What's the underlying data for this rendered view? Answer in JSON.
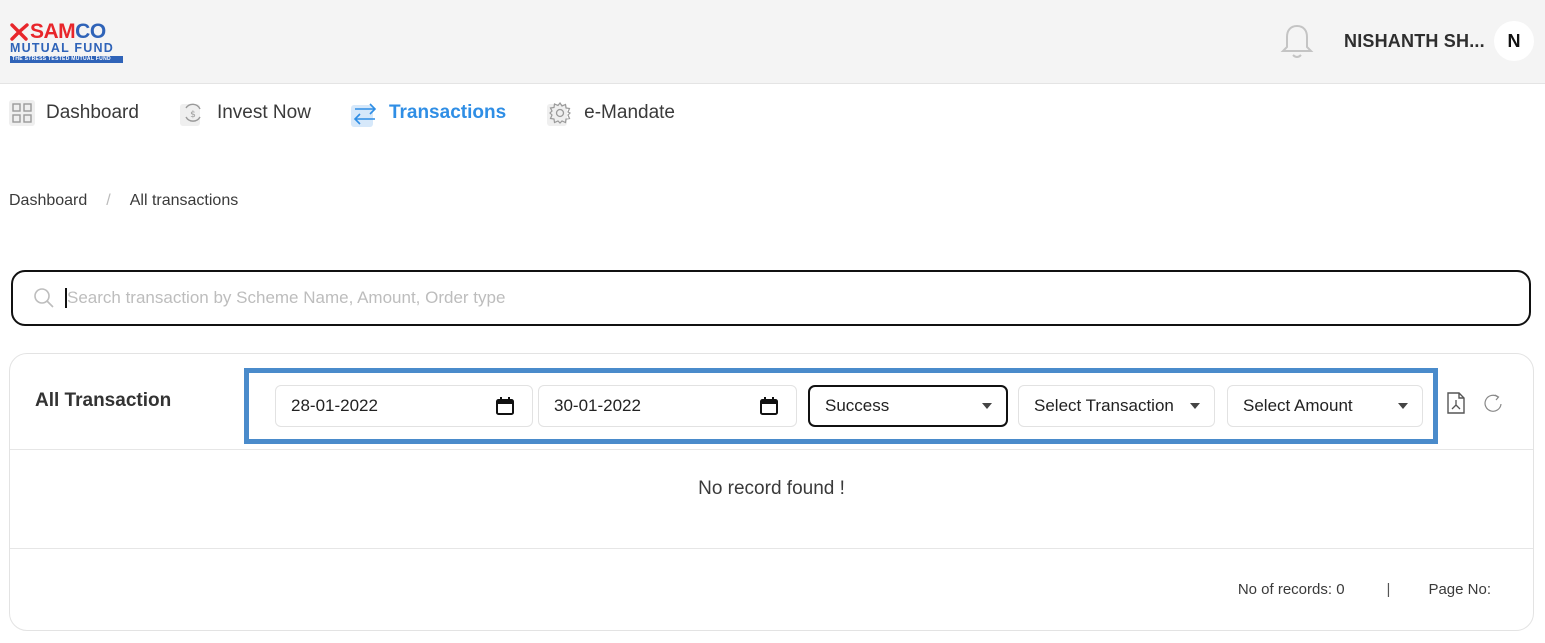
{
  "brand": {
    "name_part1": "SAM",
    "name_part2": "CO",
    "line2": "MUTUAL FUND",
    "tagline": "THE STRESS TESTED MUTUAL FUND",
    "colors": {
      "red": "#e8262b",
      "blue": "#2f63b8"
    }
  },
  "header": {
    "notification_icon": "bell-icon",
    "user_name": "NISHANTH SH...",
    "avatar_initial": "N"
  },
  "nav": {
    "items": [
      {
        "label": "Dashboard",
        "icon": "grid-icon",
        "active": false
      },
      {
        "label": "Invest Now",
        "icon": "rupee-cycle-icon",
        "active": false
      },
      {
        "label": "Transactions",
        "icon": "swap-arrows-icon",
        "active": true
      },
      {
        "label": "e-Mandate",
        "icon": "gear-icon",
        "active": false
      }
    ],
    "active_color": "#2f8ee5"
  },
  "breadcrumb": {
    "items": [
      "Dashboard",
      "All transactions"
    ],
    "separator": "/"
  },
  "search": {
    "value": "",
    "placeholder": "Search transaction by Scheme Name, Amount, Order type"
  },
  "transactions": {
    "title": "All Transaction",
    "filters": {
      "from_date": "28-01-2022",
      "to_date": "30-01-2022",
      "status": "Success",
      "transaction_type": "Select Transaction",
      "amount": "Select Amount"
    },
    "highlight_color": "#4a8bcb",
    "empty_message": "No record found !",
    "footer": {
      "records_label": "No of records: 0",
      "separator": "|",
      "page_label": "Page No:"
    }
  }
}
